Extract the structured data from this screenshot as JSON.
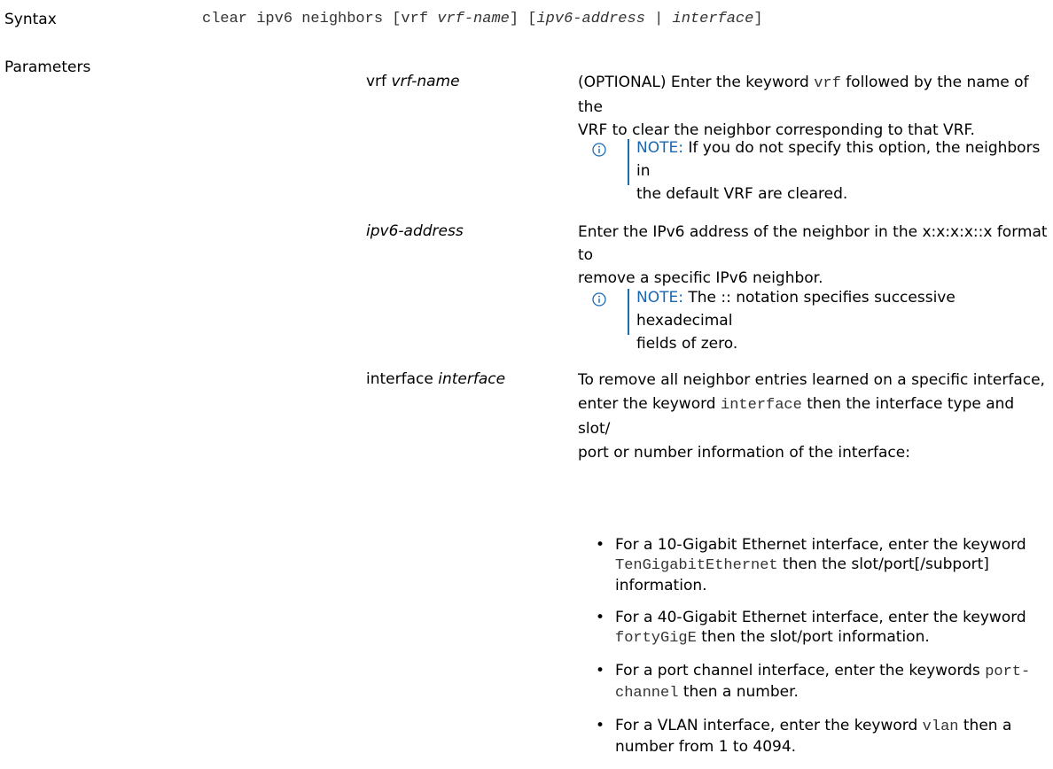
{
  "syntax": {
    "label": "Syntax",
    "cmd": "clear ipv6 neighbors [vrf ",
    "vrf_name": "vrf-name",
    "mid": "] [",
    "ipv6_address": "ipv6-address",
    "pipe": " | ",
    "interface": "interface",
    "end": "]"
  },
  "parameters": {
    "label": "Parameters",
    "vrf": {
      "term_a": "vrf ",
      "term_b": "vrf-name",
      "desc_1a": "(OPTIONAL) Enter the keyword ",
      "desc_1kw": "vrf",
      "desc_1b": " followed by the name of the",
      "desc_2": "VRF to clear the neighbor corresponding to that VRF.",
      "note_label": "NOTE:",
      "note_1": " If you do not specify this option, the neighbors in",
      "note_2": "the default VRF are cleared."
    },
    "ipv6": {
      "term": "ipv6-address",
      "desc_1": "Enter the IPv6 address of the neighbor in the x:x:x:x::x format to",
      "desc_2": "remove a specific IPv6 neighbor.",
      "note_label": "NOTE:",
      "note_1": " The :: notation specifies successive hexadecimal",
      "note_2": "fields of zero."
    },
    "interface": {
      "term_a": "interface ",
      "term_b": "interface",
      "desc_1": "To remove all neighbor entries learned on a specific interface,",
      "desc_2a": "enter the keyword ",
      "desc_2kw": "interface",
      "desc_2b": " then the interface type and slot/",
      "desc_3": "port or number information of the interface:",
      "bullets": [
        {
          "a": "For a 10-Gigabit Ethernet interface, enter the keyword",
          "kw": "TenGigabitEthernet",
          "b": " then the slot/port[/subport]",
          "c": "information."
        },
        {
          "a": "For a 40-Gigabit Ethernet interface, enter the keyword",
          "kw": "fortyGigE",
          "b": " then the slot/port information.",
          "c": ""
        },
        {
          "a": "For a port channel interface, enter the keywords ",
          "kw1": "port-",
          "kw2": "channel",
          "b": " then a number."
        },
        {
          "a": "For a VLAN interface, enter the keyword ",
          "kw": "vlan",
          "b": " then a",
          "c": "number from 1 to 4094."
        }
      ]
    }
  }
}
